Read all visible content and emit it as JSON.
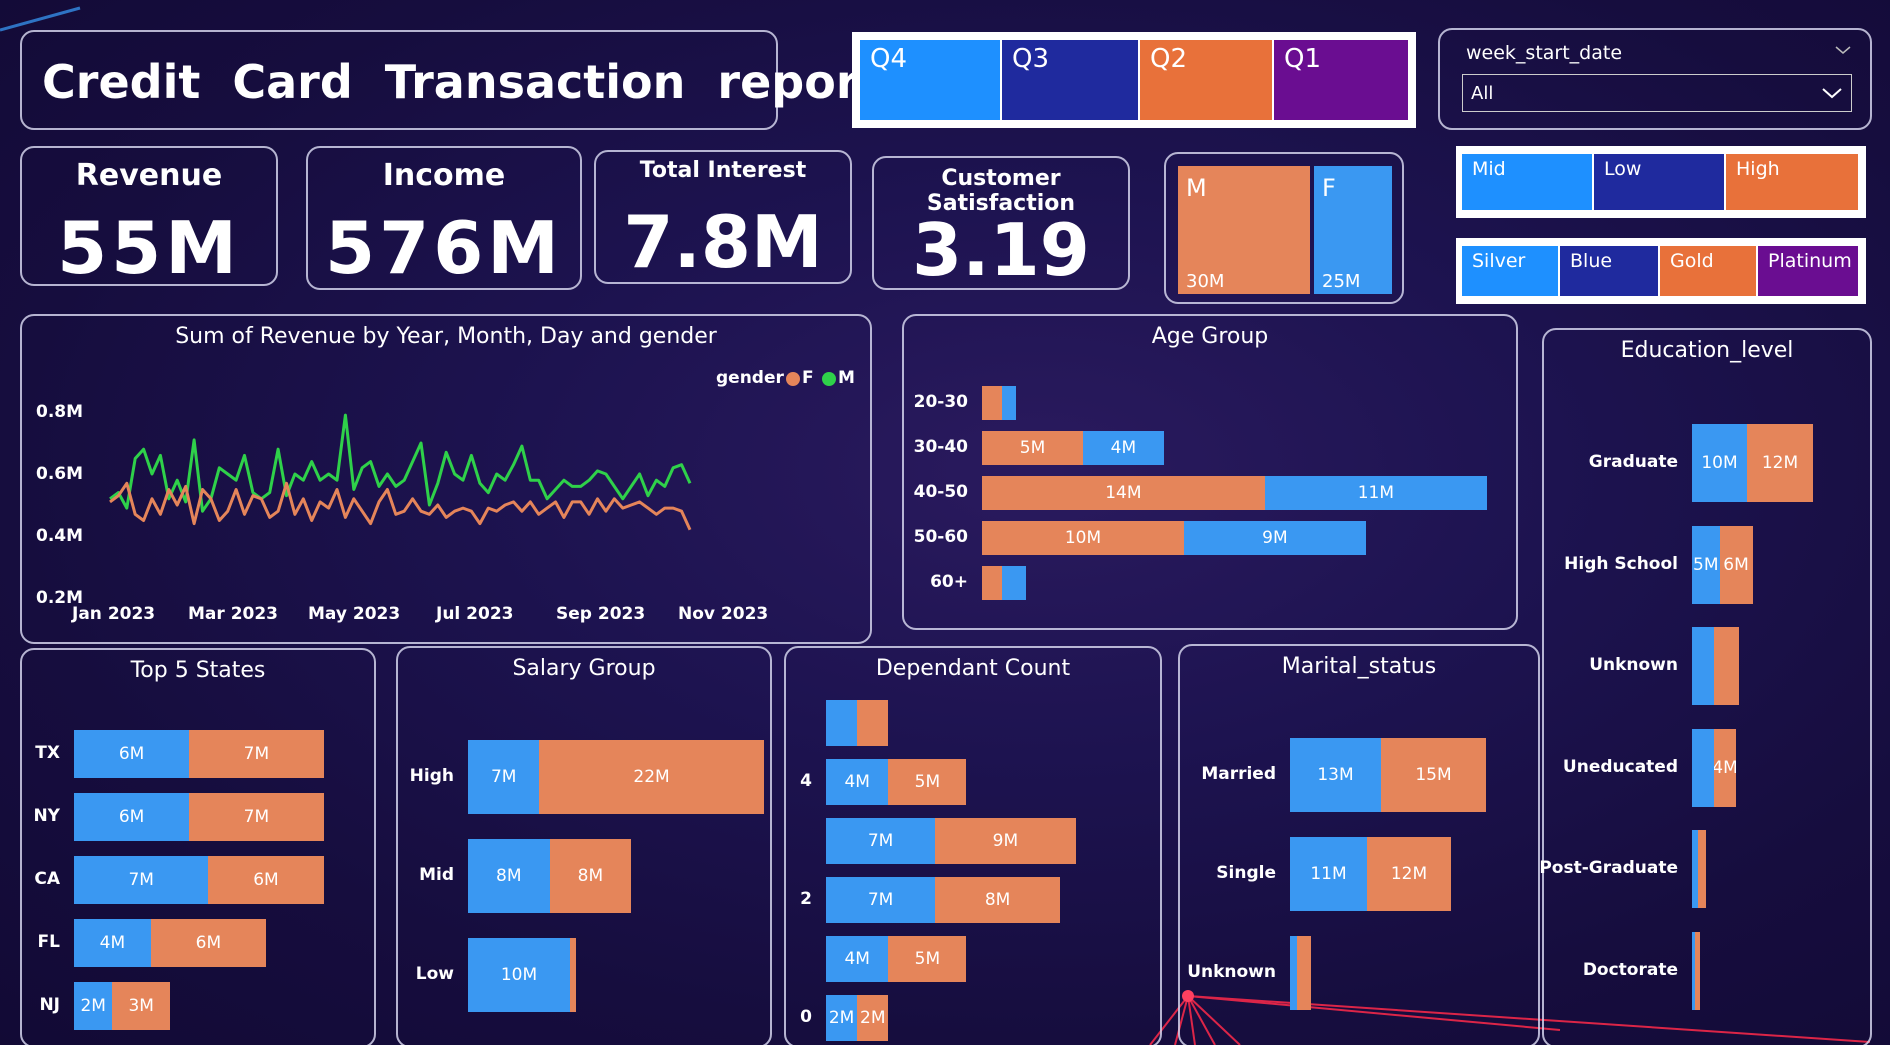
{
  "report_title": "Credit  Card  Transaction  report",
  "kpis": {
    "revenue": {
      "label": "Revenue",
      "value": "55M"
    },
    "income": {
      "label": "Income",
      "value": "576M"
    },
    "total_interest": {
      "label": "Total Interest",
      "value": "7.8M"
    },
    "customer_satisfaction": {
      "label": "Customer Satisfaction",
      "value": "3.19"
    }
  },
  "quarter_slicer": {
    "items": [
      "Q4",
      "Q3",
      "Q2",
      "Q1"
    ],
    "colors": [
      "#1e90ff",
      "#1f2a9e",
      "#e8713a",
      "#6a0d91"
    ]
  },
  "week_filter": {
    "label": "week_start_date",
    "value": "All"
  },
  "gender_tree": {
    "m_label": "M",
    "m_value": "30M",
    "f_label": "F",
    "f_value": "25M"
  },
  "income_slicer": {
    "items": [
      "Mid",
      "Low",
      "High"
    ],
    "colors": [
      "#1e90ff",
      "#1f2a9e",
      "#e8713a"
    ]
  },
  "card_slicer": {
    "items": [
      "Silver",
      "Blue",
      "Gold",
      "Platinum"
    ],
    "colors": [
      "#1e90ff",
      "#1f2a9e",
      "#e8713a",
      "#6a0d91"
    ]
  },
  "revenue_chart": {
    "title": "Sum of Revenue by Year, Month, Day and gender",
    "legend_label": "gender",
    "legend_f": "F",
    "legend_m": "M",
    "y_ticks": [
      "0.8M",
      "0.6M",
      "0.4M",
      "0.2M"
    ],
    "x_ticks": [
      "Jan 2023",
      "Mar 2023",
      "May 2023",
      "Jul 2023",
      "Sep 2023",
      "Nov 2023"
    ]
  },
  "chart_data": [
    {
      "type": "line",
      "title": "Sum of Revenue by Year, Month, Day and gender",
      "ylim": [
        0.2,
        0.8
      ],
      "ylabel": "",
      "series": [
        {
          "name": "M",
          "color": "#2fd14a",
          "values": [
            0.52,
            0.54,
            0.49,
            0.65,
            0.68,
            0.6,
            0.66,
            0.52,
            0.58,
            0.51,
            0.71,
            0.48,
            0.52,
            0.62,
            0.6,
            0.58,
            0.66,
            0.54,
            0.52,
            0.54,
            0.68,
            0.53,
            0.6,
            0.58,
            0.64,
            0.58,
            0.6,
            0.58,
            0.79,
            0.55,
            0.62,
            0.64,
            0.56,
            0.6,
            0.56,
            0.58,
            0.64,
            0.7,
            0.5,
            0.57,
            0.67,
            0.6,
            0.58,
            0.66,
            0.57,
            0.54,
            0.6,
            0.58,
            0.63,
            0.69,
            0.58,
            0.58,
            0.52,
            0.55,
            0.58,
            0.56,
            0.56,
            0.58,
            0.61,
            0.6,
            0.56,
            0.52,
            0.56,
            0.6,
            0.53,
            0.58,
            0.56,
            0.62,
            0.63,
            0.57
          ]
        },
        {
          "name": "F",
          "color": "#e5855a",
          "values": [
            0.51,
            0.53,
            0.57,
            0.47,
            0.45,
            0.52,
            0.47,
            0.55,
            0.5,
            0.56,
            0.44,
            0.55,
            0.52,
            0.45,
            0.48,
            0.55,
            0.47,
            0.53,
            0.52,
            0.46,
            0.48,
            0.57,
            0.47,
            0.52,
            0.45,
            0.51,
            0.49,
            0.55,
            0.46,
            0.52,
            0.48,
            0.44,
            0.51,
            0.55,
            0.47,
            0.48,
            0.52,
            0.48,
            0.47,
            0.5,
            0.46,
            0.48,
            0.49,
            0.48,
            0.44,
            0.49,
            0.48,
            0.5,
            0.51,
            0.48,
            0.51,
            0.47,
            0.49,
            0.51,
            0.46,
            0.51,
            0.51,
            0.47,
            0.52,
            0.48,
            0.52,
            0.49,
            0.5,
            0.51,
            0.49,
            0.47,
            0.49,
            0.49,
            0.48,
            0.42
          ]
        }
      ]
    },
    {
      "type": "bar",
      "title": "Age Group",
      "categories": [
        "20-30",
        "30-40",
        "40-50",
        "50-60",
        "60+"
      ],
      "series": [
        {
          "name": "F",
          "values": [
            1,
            5,
            14,
            10,
            1
          ],
          "labels": [
            "",
            "5M",
            "14M",
            "10M",
            ""
          ]
        },
        {
          "name": "M",
          "values": [
            0.7,
            4,
            11,
            9,
            1.2
          ],
          "labels": [
            "",
            "4M",
            "11M",
            "9M",
            ""
          ]
        }
      ]
    },
    {
      "type": "bar",
      "title": "Education_level",
      "categories": [
        "Graduate",
        "High School",
        "Unknown",
        "Uneducated",
        "Post-Graduate",
        "Doctorate"
      ],
      "series": [
        {
          "name": "M",
          "values": [
            10,
            5,
            4,
            4,
            1,
            0.6
          ],
          "labels": [
            "10M",
            "5M",
            "",
            "",
            "",
            ""
          ]
        },
        {
          "name": "F",
          "values": [
            12,
            6,
            4.5,
            4,
            1.5,
            0.9
          ],
          "labels": [
            "12M",
            "6M",
            "",
            "4M",
            "",
            ""
          ]
        }
      ]
    },
    {
      "type": "bar",
      "title": "Top 5 States",
      "categories": [
        "TX",
        "NY",
        "CA",
        "FL",
        "NJ"
      ],
      "series": [
        {
          "name": "M",
          "values": [
            6,
            6,
            7,
            4,
            2
          ],
          "labels": [
            "6M",
            "6M",
            "7M",
            "4M",
            "2M"
          ]
        },
        {
          "name": "F",
          "values": [
            7,
            7,
            6,
            6,
            3
          ],
          "labels": [
            "7M",
            "7M",
            "6M",
            "6M",
            "3M"
          ]
        }
      ]
    },
    {
      "type": "bar",
      "title": "Salary Group",
      "categories": [
        "High",
        "Mid",
        "Low"
      ],
      "series": [
        {
          "name": "M",
          "values": [
            7,
            8,
            10
          ],
          "labels": [
            "7M",
            "8M",
            "10M"
          ]
        },
        {
          "name": "F",
          "values": [
            22,
            8,
            0.6
          ],
          "labels": [
            "22M",
            "8M",
            ""
          ]
        }
      ]
    },
    {
      "type": "bar",
      "title": "Dependant Count",
      "categories": [
        "5",
        "4",
        "3",
        "2",
        "1",
        "0"
      ],
      "tick_labels": [
        "",
        "4",
        "",
        "2",
        "",
        "0"
      ],
      "series": [
        {
          "name": "M",
          "values": [
            2,
            4,
            7,
            7,
            4,
            2
          ],
          "labels": [
            "",
            "4M",
            "7M",
            "7M",
            "4M",
            "2M"
          ]
        },
        {
          "name": "F",
          "values": [
            2,
            5,
            9,
            8,
            5,
            2
          ],
          "labels": [
            "",
            "5M",
            "9M",
            "8M",
            "5M",
            "2M"
          ]
        }
      ]
    },
    {
      "type": "bar",
      "title": "Marital_status",
      "categories": [
        "Married",
        "Single",
        "Unknown"
      ],
      "series": [
        {
          "name": "M",
          "values": [
            13,
            11,
            1
          ],
          "labels": [
            "13M",
            "11M",
            ""
          ]
        },
        {
          "name": "F",
          "values": [
            15,
            12,
            2
          ],
          "labels": [
            "15M",
            "12M",
            ""
          ]
        }
      ]
    }
  ]
}
